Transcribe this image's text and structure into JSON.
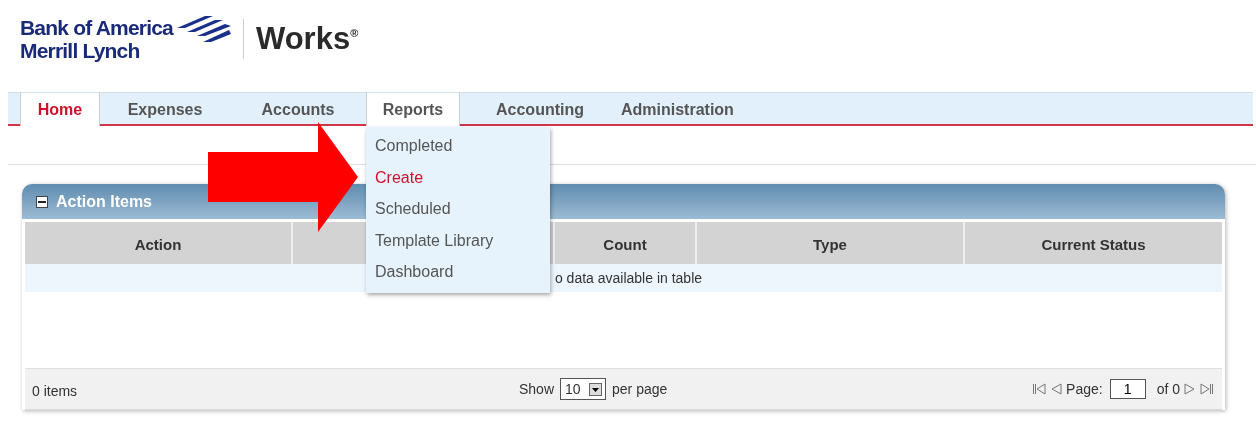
{
  "logo": {
    "bank_lines": [
      "Bank of America",
      "Merrill Lynch"
    ],
    "product": "Works",
    "product_mark": "®"
  },
  "nav": {
    "tabs": [
      {
        "label": "Home",
        "selected": true,
        "open": false
      },
      {
        "label": "Expenses",
        "selected": false,
        "open": false
      },
      {
        "label": "Accounts",
        "selected": false,
        "open": false
      },
      {
        "label": "Reports",
        "selected": false,
        "open": true
      },
      {
        "label": "Accounting",
        "selected": false,
        "open": false
      },
      {
        "label": "Administration",
        "selected": false,
        "open": false
      }
    ]
  },
  "dropdown": {
    "items": [
      {
        "label": "Completed",
        "selected": false
      },
      {
        "label": "Create",
        "selected": true
      },
      {
        "label": "Scheduled",
        "selected": false
      },
      {
        "label": "Template Library",
        "selected": false
      },
      {
        "label": "Dashboard",
        "selected": false
      }
    ]
  },
  "annotation": {
    "kind": "arrow"
  },
  "panel": {
    "title": "Action Items",
    "expanded": true,
    "columns": [
      {
        "label": "Action"
      },
      {},
      {
        "label": "Count"
      },
      {
        "label": "Type"
      },
      {
        "label": "Current Status"
      }
    ],
    "empty_message": "o data available in table",
    "footer": {
      "count": "0 items",
      "show_label": "Show",
      "page_size": "10",
      "per_page_label": "per page",
      "page_label": "Page:",
      "page": "1",
      "of_pages": "of 0"
    }
  }
}
